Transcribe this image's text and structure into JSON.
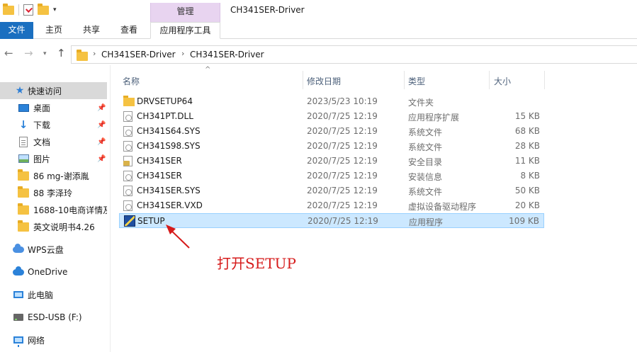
{
  "window": {
    "title": "CH341SER-Driver",
    "context_group": "管理"
  },
  "ribbon": {
    "tabs": [
      {
        "label": "文件"
      },
      {
        "label": "主页"
      },
      {
        "label": "共享"
      },
      {
        "label": "查看"
      },
      {
        "label": "应用程序工具"
      }
    ]
  },
  "address": {
    "crumbs": [
      "CH341SER-Driver",
      "CH341SER-Driver"
    ]
  },
  "sidebar": {
    "items": [
      {
        "label": "快速访问",
        "icon": "star-icon"
      },
      {
        "label": "桌面",
        "icon": "desktop-icon"
      },
      {
        "label": "下载",
        "icon": "download-icon"
      },
      {
        "label": "文档",
        "icon": "documents-icon"
      },
      {
        "label": "图片",
        "icon": "pictures-icon"
      },
      {
        "label": "86 mg-谢添胤",
        "icon": "folder-icon"
      },
      {
        "label": "88 李泽玲",
        "icon": "folder-icon"
      },
      {
        "label": "1688-10电商详情及",
        "icon": "folder-icon"
      },
      {
        "label": "英文说明书4.26",
        "icon": "folder-icon"
      },
      {
        "label": "WPS云盘",
        "icon": "cloud-icon"
      },
      {
        "label": "OneDrive",
        "icon": "onedrive-icon"
      },
      {
        "label": "此电脑",
        "icon": "pc-icon"
      },
      {
        "label": "ESD-USB (F:)",
        "icon": "usb-drive-icon"
      },
      {
        "label": "网络",
        "icon": "network-icon"
      }
    ]
  },
  "columns": {
    "name": "名称",
    "date": "修改日期",
    "type": "类型",
    "size": "大小"
  },
  "files": [
    {
      "name": "DRVSETUP64",
      "date": "2023/5/23 10:19",
      "type": "文件夹",
      "size": "",
      "icon": "folder-icon"
    },
    {
      "name": "CH341PT.DLL",
      "date": "2020/7/25 12:19",
      "type": "应用程序扩展",
      "size": "15 KB",
      "icon": "dll-file-icon"
    },
    {
      "name": "CH341S64.SYS",
      "date": "2020/7/25 12:19",
      "type": "系统文件",
      "size": "68 KB",
      "icon": "sys-file-icon"
    },
    {
      "name": "CH341S98.SYS",
      "date": "2020/7/25 12:19",
      "type": "系统文件",
      "size": "28 KB",
      "icon": "sys-file-icon"
    },
    {
      "name": "CH341SER",
      "date": "2020/7/25 12:19",
      "type": "安全目录",
      "size": "11 KB",
      "icon": "catalog-file-icon"
    },
    {
      "name": "CH341SER",
      "date": "2020/7/25 12:19",
      "type": "安装信息",
      "size": "8 KB",
      "icon": "inf-file-icon"
    },
    {
      "name": "CH341SER.SYS",
      "date": "2020/7/25 12:19",
      "type": "系统文件",
      "size": "50 KB",
      "icon": "sys-file-icon"
    },
    {
      "name": "CH341SER.VXD",
      "date": "2020/7/25 12:19",
      "type": "虚拟设备驱动程序",
      "size": "20 KB",
      "icon": "vxd-file-icon"
    },
    {
      "name": "SETUP",
      "date": "2020/7/25 12:19",
      "type": "应用程序",
      "size": "109 KB",
      "icon": "setup-exe-icon",
      "selected": true
    }
  ],
  "annotation": {
    "text": "打开SETUP",
    "color": "#d61b1b"
  }
}
